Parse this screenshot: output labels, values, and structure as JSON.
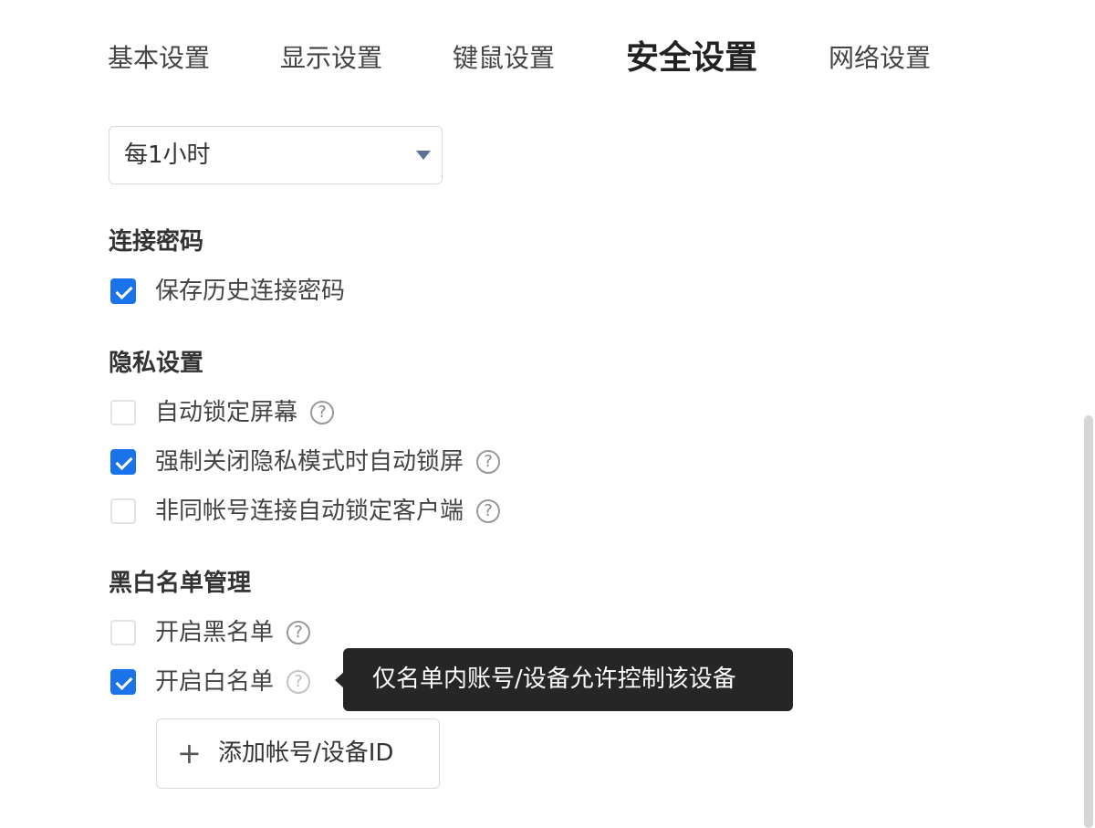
{
  "tabs": [
    {
      "label": "基本设置",
      "active": false
    },
    {
      "label": "显示设置",
      "active": false
    },
    {
      "label": "键鼠设置",
      "active": false
    },
    {
      "label": "安全设置",
      "active": true
    },
    {
      "label": "网络设置",
      "active": false
    }
  ],
  "interval_select": {
    "value": "每1小时"
  },
  "connection_password": {
    "title": "连接密码",
    "options": [
      {
        "label": "保存历史连接密码",
        "checked": true
      }
    ]
  },
  "privacy": {
    "title": "隐私设置",
    "options": [
      {
        "label": "自动锁定屏幕",
        "checked": false,
        "help": true
      },
      {
        "label": "强制关闭隐私模式时自动锁屏",
        "checked": true,
        "help": true
      },
      {
        "label": "非同帐号连接自动锁定客户端",
        "checked": false,
        "help": true
      }
    ]
  },
  "list_management": {
    "title": "黑白名单管理",
    "options": [
      {
        "label": "开启黑名单",
        "checked": false,
        "help": true
      },
      {
        "label": "开启白名单",
        "checked": true,
        "help": true
      }
    ],
    "add_button_label": "添加帐号/设备ID",
    "add_button_icon": "plus-icon"
  },
  "tooltip": {
    "text": "仅名单内账号/设备允许控制该设备"
  },
  "help_glyph": "?",
  "colors": {
    "accent": "#1a73e8",
    "tooltip_bg": "#262626",
    "select_arrow": "#5a7394"
  }
}
